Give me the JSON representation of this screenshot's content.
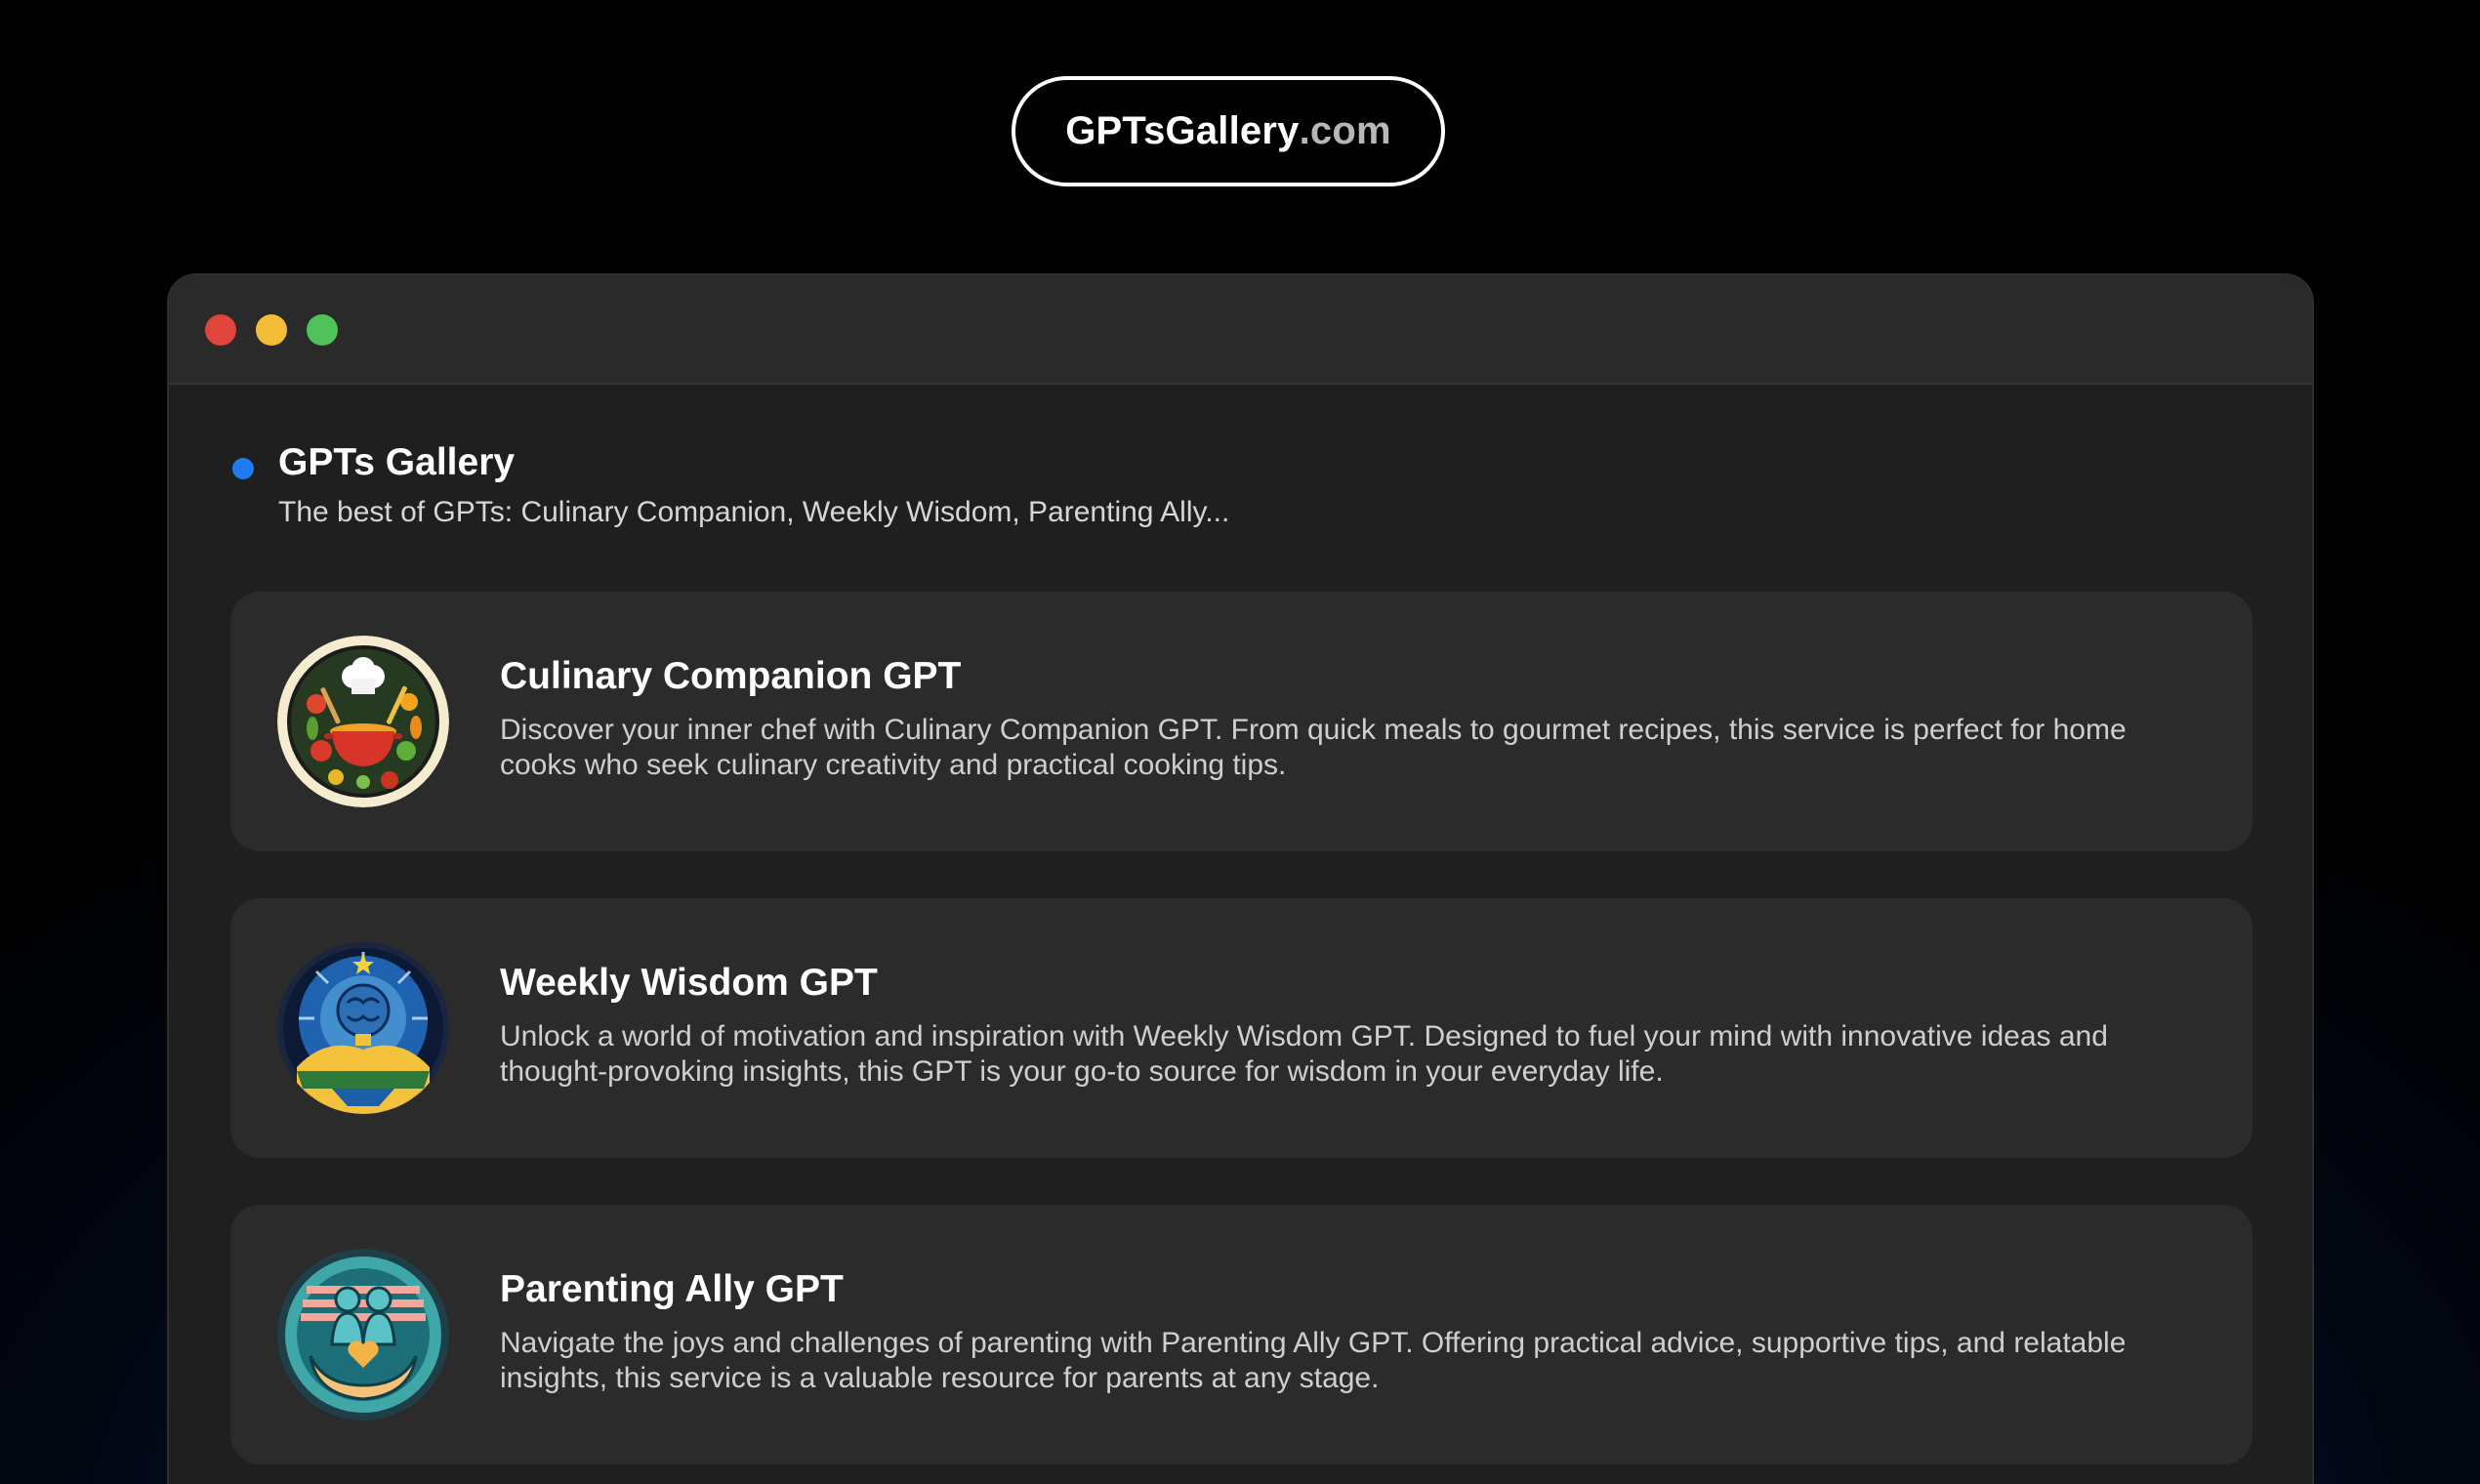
{
  "brand": {
    "name": "GPTsGallery",
    "tld": ".com"
  },
  "window": {
    "controls": [
      "close",
      "minimize",
      "maximize"
    ]
  },
  "header": {
    "title": "GPTs Gallery",
    "subtitle": "The best of GPTs: Culinary Companion, Weekly Wisdom, Parenting Ally..."
  },
  "cards": [
    {
      "title": "Culinary Companion GPT",
      "description": "Discover your inner chef with Culinary Companion GPT. From quick meals to gourmet recipes, this service is perfect for home cooks who seek culinary creativity and practical cooking tips.",
      "icon": "chef-pot-icon"
    },
    {
      "title": "Weekly Wisdom GPT",
      "description": "Unlock a world of motivation and inspiration with Weekly Wisdom GPT. Designed to fuel your mind with innovative ideas and thought-provoking insights, this GPT is your go-to source for wisdom in your everyday life.",
      "icon": "brain-lightbulb-icon"
    },
    {
      "title": "Parenting Ally GPT",
      "description": "Navigate the joys and challenges of parenting with Parenting Ally GPT. Offering practical advice, supportive tips, and relatable insights, this service is a valuable resource for parents at any stage.",
      "icon": "family-hands-heart-icon"
    }
  ],
  "colors": {
    "accent_dot": "#1e7cf2",
    "close": "#e0443a",
    "minimize": "#f4bd37",
    "maximize": "#4fc25a"
  }
}
